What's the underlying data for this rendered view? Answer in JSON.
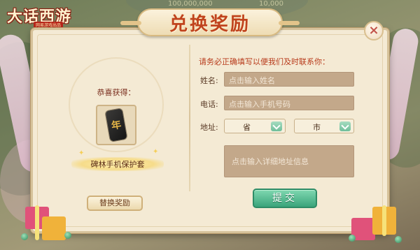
{
  "game": {
    "logo_text": "大话西游",
    "logo_sub": "网易游戏出品"
  },
  "hud": {
    "value_a": "100,000,000",
    "value_b": "10,000",
    "value_c": ""
  },
  "dialog": {
    "title": "兑换奖励",
    "close_glyph": "×",
    "reward": {
      "congrats_label": "恭喜获得：",
      "item_glyph": "年",
      "item_name": "碑林手机保护套",
      "swap_button": "替换奖励"
    },
    "form": {
      "notice": "请务必正确填写以便我们及时联系你：",
      "name_label": "姓名:",
      "name_placeholder": "点击输入姓名",
      "phone_label": "电话:",
      "phone_placeholder": "点击输入手机号码",
      "address_label": "地址:",
      "province_value": "省",
      "city_value": "市",
      "detail_placeholder": "点击输入详细地址信息",
      "submit_label": "提交"
    }
  },
  "colors": {
    "panel": "#f4ead4",
    "accent_red": "#c0431d",
    "submit_green": "#3aa57b",
    "input_fill": "#c3a88a"
  }
}
